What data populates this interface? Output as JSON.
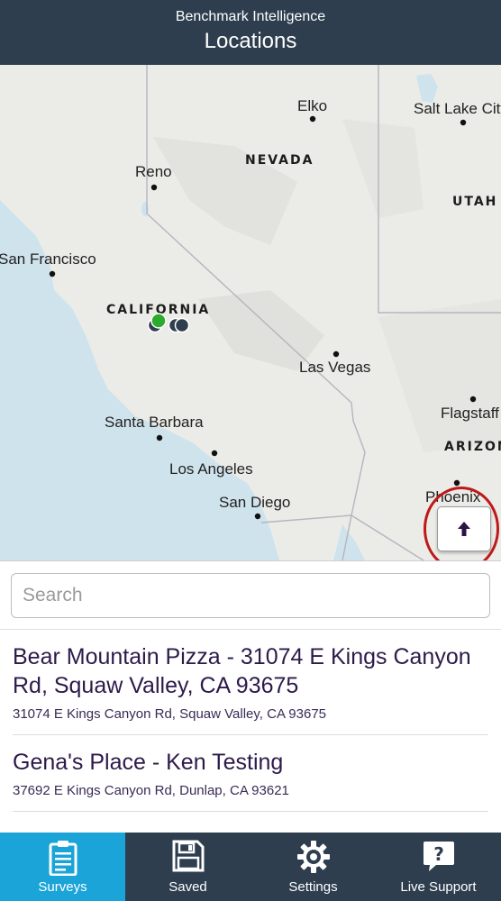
{
  "header": {
    "app_name": "Benchmark Intelligence",
    "title": "Locations"
  },
  "map": {
    "cities": [
      {
        "name": "Elko"
      },
      {
        "name": "Salt Lake City"
      },
      {
        "name": "Reno"
      },
      {
        "name": "San Francisco"
      },
      {
        "name": "Las Vegas"
      },
      {
        "name": "Flagstaff"
      },
      {
        "name": "Santa Barbara"
      },
      {
        "name": "Los Angeles"
      },
      {
        "name": "San Diego"
      },
      {
        "name": "Phoenix"
      }
    ],
    "states": [
      {
        "name": "NEVADA"
      },
      {
        "name": "UTAH"
      },
      {
        "name": "CALIFORNIA"
      },
      {
        "name": "ARIZONA"
      }
    ],
    "marker_colors": {
      "selected": "#2eaa2e",
      "default": "#2e3e4f"
    }
  },
  "scroll_up_button": {
    "icon": "arrow-up-icon"
  },
  "search": {
    "placeholder": "Search",
    "value": ""
  },
  "locations": [
    {
      "title": "Bear Mountain Pizza - 31074 E Kings Canyon Rd, Squaw Valley, CA 93675",
      "address": "31074 E Kings Canyon Rd, Squaw Valley, CA 93675"
    },
    {
      "title": "Gena's Place - Ken Testing",
      "address": "37692 E Kings Canyon Rd, Dunlap, CA 93621"
    }
  ],
  "tabs": [
    {
      "label": "Surveys",
      "icon": "clipboard-icon",
      "active": true
    },
    {
      "label": "Saved",
      "icon": "floppy-disk-icon",
      "active": false
    },
    {
      "label": "Settings",
      "icon": "gear-icon",
      "active": false
    },
    {
      "label": "Live Support",
      "icon": "speech-bubble-question-icon",
      "active": false
    }
  ],
  "colors": {
    "header_bg": "#2e3e4f",
    "tab_active": "#1aa4d8",
    "text_primary": "#2d1a4a",
    "ocean": "#cfe3ec",
    "highlight_ring": "#c01818"
  }
}
